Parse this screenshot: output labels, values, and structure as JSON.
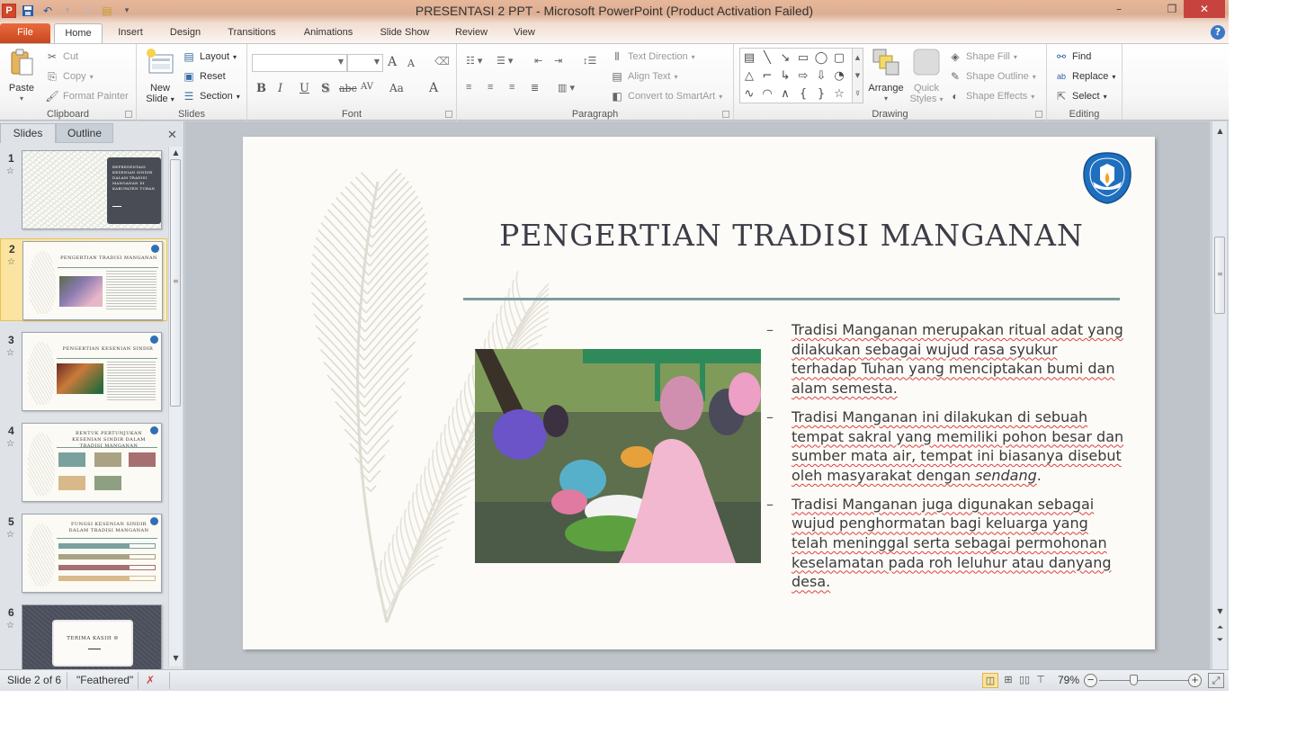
{
  "window": {
    "title": "PRESENTASI 2 PPT  -  Microsoft PowerPoint (Product Activation Failed)",
    "minimize_label": "–",
    "maximize_label": "❐",
    "close_label": "✕",
    "help_label": "?",
    "ribbon_collapse_label": "^"
  },
  "quick_access": {
    "app_icon": "P",
    "save_icon": "💾",
    "undo_icon": "↶",
    "redo_icon": "↻",
    "new_icon": "▤",
    "customize_icon": "▾"
  },
  "tabs": [
    {
      "label": "File"
    },
    {
      "label": "Home"
    },
    {
      "label": "Insert"
    },
    {
      "label": "Design"
    },
    {
      "label": "Transitions"
    },
    {
      "label": "Animations"
    },
    {
      "label": "Slide Show"
    },
    {
      "label": "Review"
    },
    {
      "label": "View"
    }
  ],
  "ribbon": {
    "clipboard": {
      "label": "Clipboard",
      "paste": "Paste",
      "cut": "Cut",
      "copy": "Copy",
      "format_painter": "Format Painter"
    },
    "slides": {
      "label": "Slides",
      "new_slide_line1": "New",
      "new_slide_line2": "Slide",
      "layout": "Layout",
      "reset": "Reset",
      "section": "Section"
    },
    "font": {
      "label": "Font",
      "font_name_value": "",
      "font_size_value": "",
      "grow": "A",
      "shrink": "A",
      "bold": "B",
      "italic": "I",
      "underline": "U",
      "shadow": "S",
      "strike": "abc",
      "spacing": "AV",
      "case": "Aa",
      "color": "A"
    },
    "paragraph": {
      "label": "Paragraph",
      "text_direction": "Text Direction",
      "align_text": "Align Text",
      "convert_smartart": "Convert to SmartArt"
    },
    "drawing": {
      "label": "Drawing",
      "arrange": "Arrange",
      "quick_styles_line1": "Quick",
      "quick_styles_line2": "Styles",
      "shape_fill": "Shape Fill",
      "shape_outline": "Shape Outline",
      "shape_effects": "Shape Effects",
      "shapes": [
        "▤",
        "╲",
        "↘",
        "▭",
        "◯",
        "▢",
        "△",
        "⌐",
        "↳",
        "⇨",
        "⇩",
        "◔",
        "∿",
        "◠",
        "∧",
        "{",
        "}",
        "☆"
      ]
    },
    "editing": {
      "label": "Editing",
      "find": "Find",
      "replace": "Replace",
      "select": "Select"
    }
  },
  "panel": {
    "tab_slides": "Slides",
    "tab_outline": "Outline",
    "close_label": "✕",
    "thumbnails": [
      {
        "number": "1",
        "title": "REPRESENTASI KESENIAN SINDIR DALAM TRADISI MANGANAN DI KABUPATEN TUBAN",
        "selected": false
      },
      {
        "number": "2",
        "title": "PENGERTIAN TRADISI MANGANAN",
        "selected": true
      },
      {
        "number": "3",
        "title": "PENGERTIAN KESENIAN SINDIR",
        "selected": false
      },
      {
        "number": "4",
        "title": "BENTUK PERTUNJUKAN KESENIAN SINDIR DALAM TRADISI MANGANAN",
        "selected": false
      },
      {
        "number": "5",
        "title": "FUNGSI KESENIAN SINDIR DALAM TRADISI MANGANAN",
        "selected": false
      },
      {
        "number": "6",
        "title": "TERIMA KASIH ☺",
        "selected": false
      }
    ]
  },
  "slide": {
    "title": "PENGERTIAN TRADISI MANGANAN",
    "accent_color": "#7e9c9c",
    "bullets": [
      {
        "dash": "–",
        "text": "Tradisi Manganan merupakan  ritual adat yang dilakukan sebagai wujud rasa syukur terhadap Tuhan yang menciptakan bumi dan alam semesta."
      },
      {
        "dash": "–",
        "text_before": "Tradisi Manganan ini dilakukan di sebuah tempat sakral yang memiliki pohon besar dan sumber mata air, tempat ini biasanya disebut oleh masyarakat dengan ",
        "text_italic": "sendang",
        "text_after": "."
      },
      {
        "dash": "–",
        "text": "Tradisi Manganan juga digunakan sebagai wujud penghormatan bagi keluarga yang telah meninggal serta sebagai permohonan keselamatan pada roh leluhur atau danyang desa."
      }
    ],
    "photo_alt": "Warga berkumpul dalam tradisi Manganan"
  },
  "statusbar": {
    "slide_position": "Slide 2 of 6",
    "theme": "\"Feathered\"",
    "zoom": "79%",
    "zoom_percent": 79
  }
}
